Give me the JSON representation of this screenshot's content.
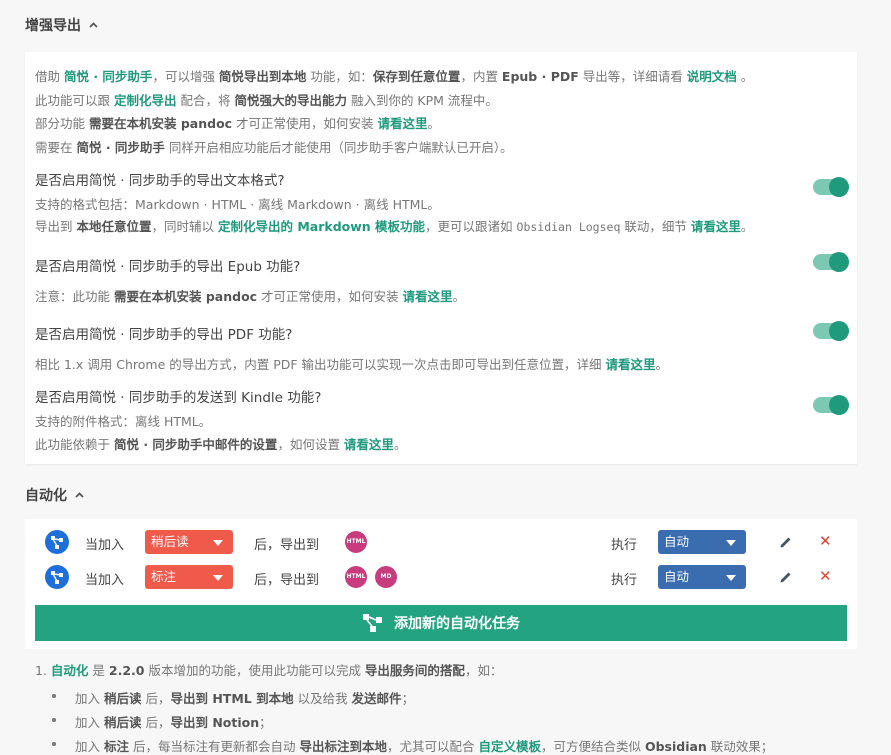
{
  "export_section": {
    "title": "增强导出",
    "intro": {
      "l1": [
        "借助 ",
        "简悦 · 同步助手",
        "，可以增强 ",
        "简悦导出到本地",
        " 功能，如：",
        "保存到任意位置",
        "，内置 ",
        "Epub · PDF",
        " 导出等，详细请看 ",
        "说明文档",
        " 。"
      ],
      "l2": [
        "此功能可以跟 ",
        "定制化导出",
        " 配合，将 ",
        "简悦强大的导出能力",
        " 融入到你的 KPM 流程中。"
      ],
      "l3": [
        "部分功能 ",
        "需要在本机安装 pandoc",
        " 才可正常使用，如何安装 ",
        "请看这里",
        "。"
      ],
      "l4": [
        "需要在 ",
        "简悦 · 同步助手",
        " 同样开启相应功能后才能使用（同步助手客户端默认已开启）。"
      ]
    },
    "options": [
      {
        "q": "是否启用简悦 · 同步助手的导出文本格式?",
        "d1": [
          "支持的格式包括：Markdown · HTML · 离线 Markdown · 离线 HTML。"
        ],
        "d2": [
          "导出到 ",
          "本地任意位置",
          "，同时辅以 ",
          "定制化导出的 Markdown 模板功能",
          "，更可以跟诸如 ",
          "Obsidian Logseq",
          " 联动，细节 ",
          "请看这里",
          "。"
        ]
      },
      {
        "q": "是否启用简悦 · 同步助手的导出 Epub 功能?",
        "d1": [
          "注意：此功能 ",
          "需要在本机安装 pandoc",
          " 才可正常使用，如何安装 ",
          "请看这里",
          "。"
        ]
      },
      {
        "q": "是否启用简悦 · 同步助手的导出 PDF 功能?",
        "d1": [
          "相比 1.x 调用 Chrome 的导出方式，内置 PDF 输出功能可以实现一次点击即可导出到任意位置，详细 ",
          "请看这里",
          "。"
        ]
      },
      {
        "q": "是否启用简悦 · 同步助手的发送到 Kindle 功能?",
        "d1": [
          "支持的附件格式：离线 HTML。"
        ],
        "d2": [
          "此功能依赖于 ",
          "简悦 · 同步助手中邮件的设置",
          "，如何设置 ",
          "请看这里",
          "。"
        ]
      }
    ]
  },
  "auto_section": {
    "title": "自动化",
    "rows": [
      {
        "when": "当加入",
        "trigger": "稍后读",
        "then": "后，导出到",
        "badges": [
          "HTML"
        ],
        "exec": "执行",
        "mode": "自动"
      },
      {
        "when": "当加入",
        "trigger": "标注",
        "then": "后，导出到",
        "badges": [
          "HTML",
          "MD"
        ],
        "exec": "执行",
        "mode": "自动"
      }
    ],
    "add_button": "添加新的自动化任务",
    "notes": {
      "n1": [
        "1. ",
        "自动化",
        " 是 ",
        "2.2.0",
        " 版本增加的功能，使用此功能可以完成 ",
        "导出服务间的搭配",
        "，如："
      ],
      "b1": [
        "加入 ",
        "稍后读",
        " 后，",
        "导出到 HTML 到本地",
        " 以及给我 ",
        "发送邮件",
        "；"
      ],
      "b2": [
        "加入 ",
        "稍后读",
        " 后，",
        "导出到 Notion",
        "；"
      ],
      "b3": [
        "加入 ",
        "标注",
        " 后，每当标注有更新都会自动 ",
        "导出标注到本地",
        "，尤其可以配合 ",
        "自定义模板",
        "，可方便结合类似 ",
        "Obsidian",
        " 联动效果；"
      ]
    }
  }
}
